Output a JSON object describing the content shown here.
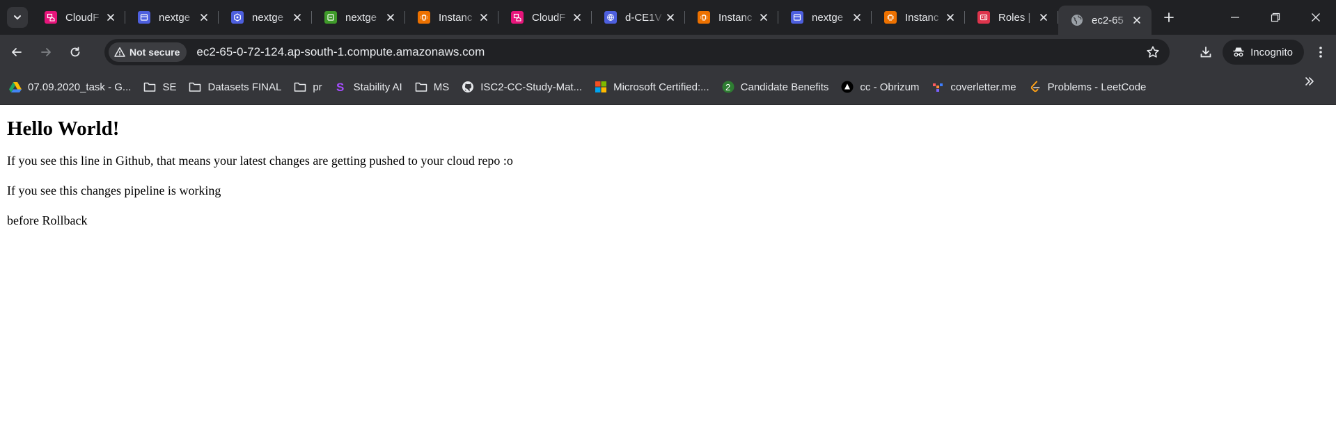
{
  "tabs": [
    {
      "title": "CloudF",
      "icon": "pink-service-icon",
      "color": "#e7157b",
      "active": false
    },
    {
      "title": "nextge",
      "icon": "blue-service-icon",
      "color": "#4d5fde",
      "active": false
    },
    {
      "title": "nextge",
      "icon": "blue-hex-service-icon",
      "color": "#4d5fde",
      "active": false
    },
    {
      "title": "nextge",
      "icon": "green-service-icon",
      "color": "#3f9a2a",
      "active": false
    },
    {
      "title": "Instanc",
      "icon": "ec2-instance-icon",
      "color": "#ed7100",
      "active": false
    },
    {
      "title": "CloudF",
      "icon": "pink-service-icon",
      "color": "#e7157b",
      "active": false
    },
    {
      "title": "d-CE1V",
      "icon": "blue-globe-service-icon",
      "color": "#4d5fde",
      "active": false
    },
    {
      "title": "Instanc",
      "icon": "ec2-instance-icon",
      "color": "#ed7100",
      "active": false
    },
    {
      "title": "nextge",
      "icon": "blue-service-icon",
      "color": "#4d5fde",
      "active": false
    },
    {
      "title": "Instanc",
      "icon": "ec2-instance-icon",
      "color": "#ed7100",
      "active": false
    },
    {
      "title": "Roles |",
      "icon": "iam-roles-icon",
      "color": "#dd344c",
      "active": false
    },
    {
      "title": "ec2-65",
      "icon": "globe-icon",
      "color": "#9aa0a6",
      "active": true
    }
  ],
  "toolbar": {
    "security_label": "Not secure",
    "url": "ec2-65-0-72-124.ap-south-1.compute.amazonaws.com",
    "incognito_label": "Incognito"
  },
  "bookmarks": [
    {
      "label": "07.09.2020_task - G...",
      "icon": "google-drive-icon"
    },
    {
      "label": "SE",
      "icon": "folder-icon"
    },
    {
      "label": "Datasets FINAL",
      "icon": "folder-icon"
    },
    {
      "label": "pr",
      "icon": "folder-icon"
    },
    {
      "label": "Stability AI",
      "icon": "stability-ai-icon"
    },
    {
      "label": "MS",
      "icon": "folder-icon"
    },
    {
      "label": "ISC2-CC-Study-Mat...",
      "icon": "github-icon"
    },
    {
      "label": "Microsoft Certified:...",
      "icon": "microsoft-icon"
    },
    {
      "label": "Candidate Benefits",
      "icon": "candidate-benefits-icon"
    },
    {
      "label": "cc - Obrizum",
      "icon": "obrizum-icon"
    },
    {
      "label": "coverletter.me",
      "icon": "coverletter-icon"
    },
    {
      "label": "Problems - LeetCode",
      "icon": "leetcode-icon"
    }
  ],
  "page": {
    "heading": "Hello World!",
    "paragraphs": [
      "If you see this line in Github, that means your latest changes are getting pushed to your cloud repo :o",
      "If you see this changes pipeline is working",
      "before Rollback"
    ]
  }
}
